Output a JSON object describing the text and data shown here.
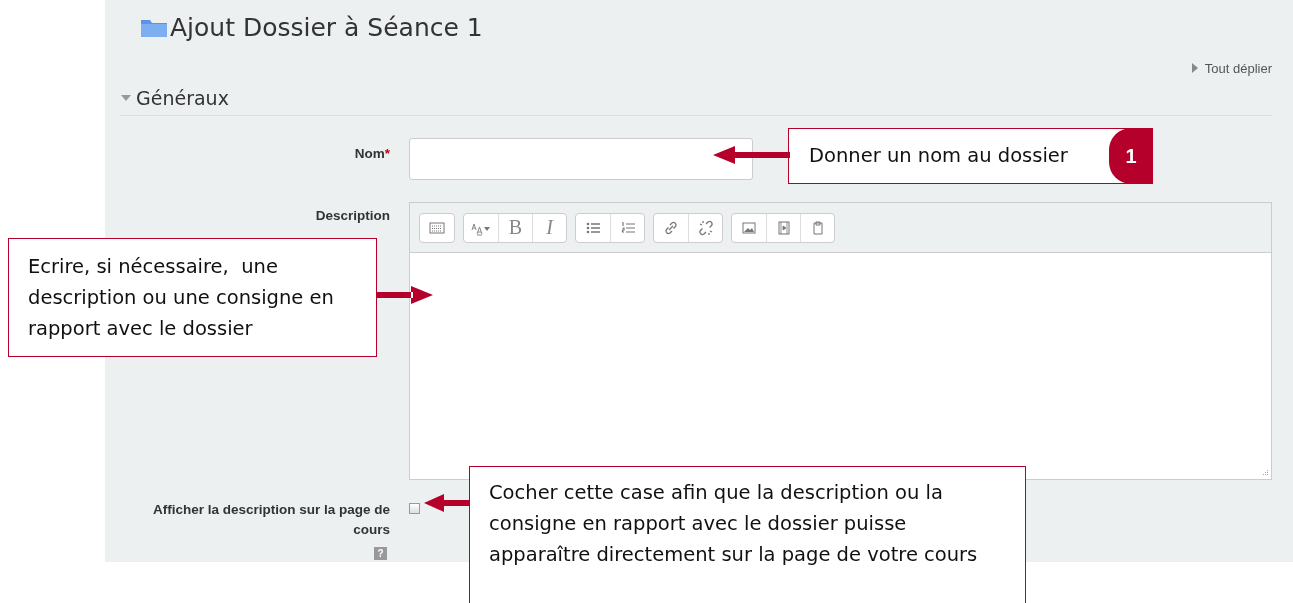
{
  "page": {
    "title": "Ajout Dossier à Séance 1",
    "expand_all": "Tout déplier"
  },
  "section": {
    "title": "Généraux",
    "expanded": true
  },
  "fields": [
    {
      "kind": "text",
      "label": "Nom",
      "required_mark": "*"
    },
    {
      "kind": "editor",
      "label": "Description",
      "toolbar": [
        [
          {
            "kind": "keyboard"
          }
        ],
        [
          {
            "kind": "font"
          },
          {
            "kind": "bold",
            "label": "B"
          },
          {
            "kind": "italic",
            "label": "I"
          }
        ],
        [
          {
            "kind": "bullets"
          },
          {
            "kind": "numbers"
          }
        ],
        [
          {
            "kind": "link"
          },
          {
            "kind": "unlink"
          }
        ],
        [
          {
            "kind": "image"
          },
          {
            "kind": "media"
          },
          {
            "kind": "paste"
          }
        ]
      ]
    },
    {
      "kind": "checkbox",
      "label": "Afficher la description sur la page de cours",
      "checked": false,
      "help": "?"
    }
  ],
  "callouts": [
    {
      "text": "Donner un nom au dossier",
      "badge": "1"
    },
    {
      "text": "Ecrire, si nécessaire,  une description ou une consigne en rapport avec le dossier"
    },
    {
      "text": "Cocher cette case afin que la description ou la consigne en rapport avec le dossier puisse apparaître directement sur la page de votre cours"
    }
  ]
}
